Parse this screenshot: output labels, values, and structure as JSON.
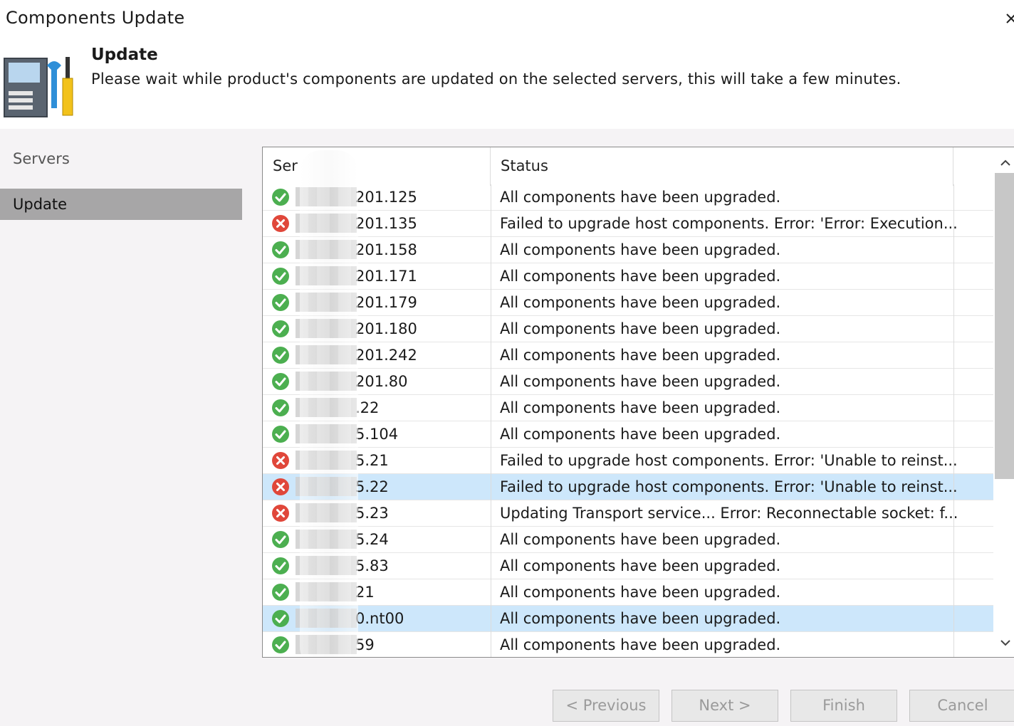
{
  "window": {
    "title": "Components Update"
  },
  "header": {
    "title": "Update",
    "description": "Please wait while product's components are updated on the selected servers, this will take a few minutes."
  },
  "sidebar": {
    "items": [
      {
        "label": "Servers",
        "active": false
      },
      {
        "label": "Update",
        "active": true
      }
    ]
  },
  "table": {
    "columns": [
      "Ser",
      "Status"
    ],
    "rows": [
      {
        "state": "success",
        "server": "201.125",
        "status": "All components have been upgraded."
      },
      {
        "state": "error",
        "server": "201.135",
        "status": "Failed to upgrade host components. Error: 'Error: Execution..."
      },
      {
        "state": "success",
        "server": "201.158",
        "status": "All components have been upgraded."
      },
      {
        "state": "success",
        "server": "201.171",
        "status": "All components have been upgraded."
      },
      {
        "state": "success",
        "server": "201.179",
        "status": "All components have been upgraded."
      },
      {
        "state": "success",
        "server": "201.180",
        "status": "All components have been upgraded."
      },
      {
        "state": "success",
        "server": "201.242",
        "status": "All components have been upgraded."
      },
      {
        "state": "success",
        "server": "201.80",
        "status": "All components have been upgraded."
      },
      {
        "state": "success",
        "server": ".22",
        "status": "All components have been upgraded."
      },
      {
        "state": "success",
        "server": "5.104",
        "status": "All components have been upgraded."
      },
      {
        "state": "error",
        "server": "5.21",
        "status": "Failed to upgrade host components. Error: 'Unable to reinst..."
      },
      {
        "state": "error",
        "server": "5.22",
        "status": "Failed to upgrade host components. Error: 'Unable to reinst...",
        "selected": true
      },
      {
        "state": "error",
        "server": "5.23",
        "status": "Updating Transport service... Error: Reconnectable socket: f..."
      },
      {
        "state": "success",
        "server": "5.24",
        "status": "All components have been upgraded."
      },
      {
        "state": "success",
        "server": "5.83",
        "status": "All components have been upgraded."
      },
      {
        "state": "success",
        "server": "21",
        "status": "All components have been upgraded."
      },
      {
        "state": "success",
        "server": "0.nt00",
        "status": "All components have been upgraded.",
        "highlight": true
      },
      {
        "state": "success",
        "server": "59",
        "status": "All components have been upgraded."
      }
    ]
  },
  "footer": {
    "previous_label": "< Previous",
    "next_label": "Next >",
    "finish_label": "Finish",
    "cancel_label": "Cancel"
  },
  "colors": {
    "success": "#4caf50",
    "error": "#e0473a",
    "selected_row": "#cde7fb",
    "sidebar_active": "#a7a6a7"
  },
  "icons": {
    "success": "check-circle-icon",
    "error": "error-circle-icon",
    "close": "close-icon",
    "header": "server-tools-icon",
    "scroll_up": "chevron-up-icon",
    "scroll_down": "chevron-down-icon"
  }
}
